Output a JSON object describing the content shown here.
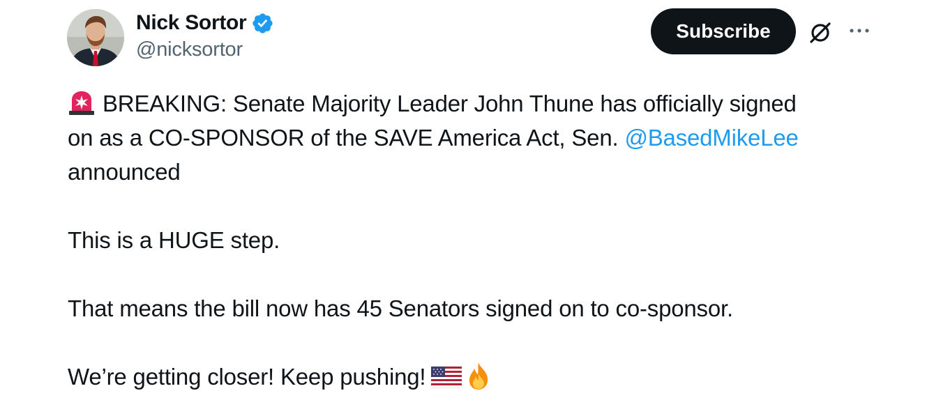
{
  "author": {
    "display_name": "Nick Sortor",
    "handle": "@nicksortor",
    "verified": true,
    "avatar_icon": "profile-photo"
  },
  "actions": {
    "subscribe_label": "Subscribe",
    "grok_icon": "grok-icon",
    "more_icon": "more-options-icon"
  },
  "tweet": {
    "line1_text": "BREAKING: Senate Majority Leader John Thune has officially signed",
    "line2_text": "on as a CO-SPONSOR of the SAVE America Act, Sen. ",
    "mention": "@BasedMikeLee",
    "line3_text": "announced",
    "paragraph2": "This is a HUGE step.",
    "paragraph3": "That means the bill now has 45 Senators signed on to co-sponsor.",
    "paragraph4": "We’re getting closer! Keep pushing!",
    "emojis": [
      "siren",
      "us-flag",
      "fire"
    ]
  },
  "colors": {
    "text": "#0f1419",
    "secondary_text": "#536471",
    "link": "#1d9bf0",
    "verified_badge": "#1d9bf0",
    "button_bg": "#0f1419",
    "button_text": "#ffffff"
  }
}
